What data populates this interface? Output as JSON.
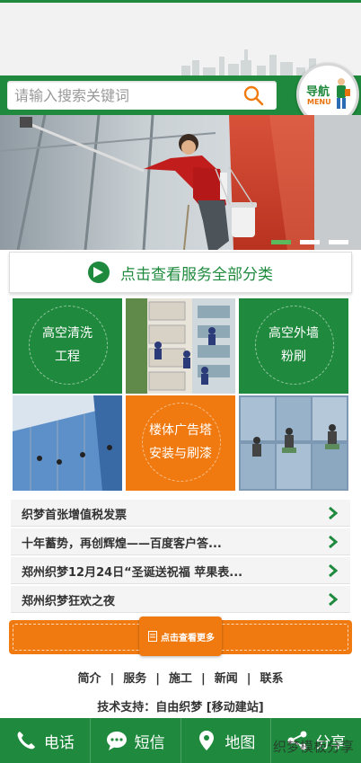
{
  "search": {
    "placeholder": "请输入搜索关键词"
  },
  "nav_button": {
    "label": "导航",
    "sublabel": "MENU"
  },
  "banner": {
    "slides": 3,
    "active_slide": 1
  },
  "category_bar": {
    "text": "点击查看服务全部分类"
  },
  "grid": {
    "cell_1": [
      "高空清洗",
      "工程"
    ],
    "cell_3": [
      "高空外墙",
      "粉刷"
    ],
    "cell_5": [
      "楼体广告塔",
      "安装与刷漆"
    ]
  },
  "news": [
    "织梦首张增值税发票",
    "十年蓄势，再创辉煌——百度客户答...",
    "郑州织梦12月24日“圣诞送祝福 苹果表...",
    "郑州织梦狂欢之夜"
  ],
  "more_button": {
    "label": "点击查看更多"
  },
  "footer_links": [
    "简介",
    "服务",
    "施工",
    "新闻",
    "联系"
  ],
  "footer_separator": "|",
  "support": "技术支持：自由织梦 [移动建站]",
  "bottom_bar": [
    {
      "label": "电话",
      "icon": "phone-icon"
    },
    {
      "label": "短信",
      "icon": "message-icon"
    },
    {
      "label": "地图",
      "icon": "map-pin-icon"
    },
    {
      "label": "分享",
      "icon": "share-icon"
    }
  ],
  "watermark": "织梦模板分享",
  "colors": {
    "primary": "#1f8a3d",
    "accent": "#f07a10"
  }
}
